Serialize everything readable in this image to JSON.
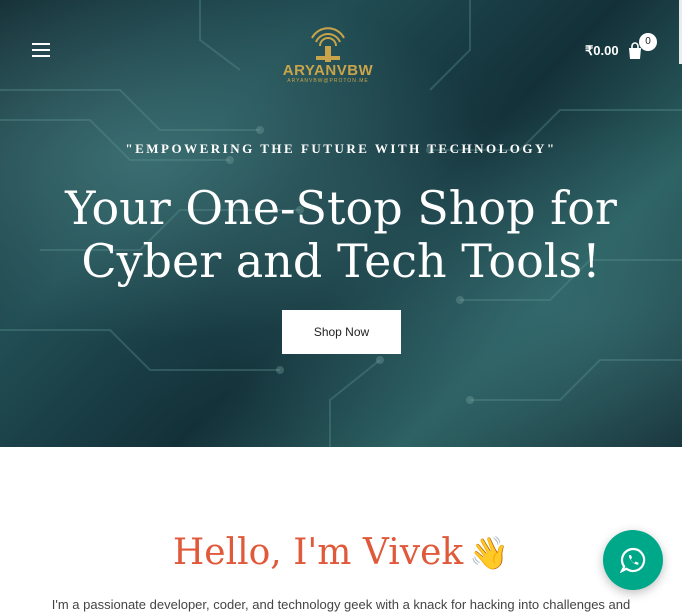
{
  "header": {
    "logo_text": "ARYANVBW",
    "logo_sub": "ARYANVBW@PROTON.ME",
    "cart_price": "₹0.00",
    "cart_count": "0"
  },
  "hero": {
    "tagline": "\"EMPOWERING THE FUTURE WITH TECHNOLOGY\"",
    "headline_line1": "Your One-Stop Shop for",
    "headline_line2": "Cyber and Tech Tools!",
    "cta_label": "Shop Now"
  },
  "intro": {
    "greeting": "Hello, I'm Vivek",
    "wave_emoji": "👋",
    "text": "I'm a passionate developer, coder, and technology geek with a knack for hacking into challenges and"
  },
  "icons": {
    "menu": "menu-icon",
    "cart": "cart-icon",
    "whatsapp": "whatsapp-icon"
  },
  "colors": {
    "accent": "#e0593a",
    "whatsapp": "#00a88a",
    "logo_gold": "#c9a44a"
  }
}
